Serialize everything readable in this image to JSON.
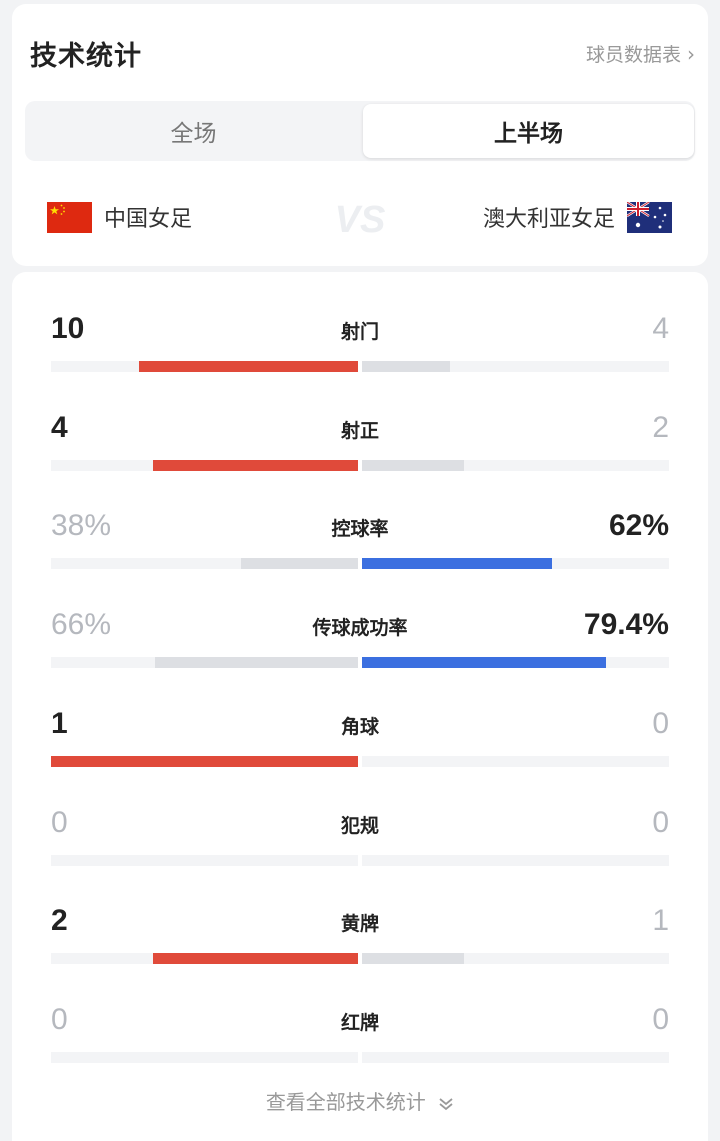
{
  "header": {
    "title": "技术统计",
    "player_link": "球员数据表"
  },
  "tabs": [
    {
      "label": "全场",
      "active": false
    },
    {
      "label": "上半场",
      "active": true
    }
  ],
  "teams": {
    "home": {
      "name": "中国女足",
      "flag": "china-flag-icon"
    },
    "vs_label": "VS",
    "away": {
      "name": "澳大利亚女足",
      "flag": "australia-flag-icon"
    }
  },
  "colors": {
    "home_accent": "#e04a3a",
    "away_accent": "#3b6fe0",
    "neutral_bar": "#dddfe3",
    "track": "#f3f4f6"
  },
  "stats": [
    {
      "label": "射门",
      "home": "10",
      "away": "4",
      "home_frac": 0.714,
      "away_frac": 0.286,
      "leader": "home"
    },
    {
      "label": "射正",
      "home": "4",
      "away": "2",
      "home_frac": 0.667,
      "away_frac": 0.333,
      "leader": "home"
    },
    {
      "label": "控球率",
      "home": "38%",
      "away": "62%",
      "home_frac": 0.38,
      "away_frac": 0.62,
      "leader": "away"
    },
    {
      "label": "传球成功率",
      "home": "66%",
      "away": "79.4%",
      "home_frac": 0.66,
      "away_frac": 0.794,
      "leader": "away"
    },
    {
      "label": "角球",
      "home": "1",
      "away": "0",
      "home_frac": 1.0,
      "away_frac": 0.0,
      "leader": "home"
    },
    {
      "label": "犯规",
      "home": "0",
      "away": "0",
      "home_frac": 0.0,
      "away_frac": 0.0,
      "leader": "none"
    },
    {
      "label": "黄牌",
      "home": "2",
      "away": "1",
      "home_frac": 0.667,
      "away_frac": 0.333,
      "leader": "home"
    },
    {
      "label": "红牌",
      "home": "0",
      "away": "0",
      "home_frac": 0.0,
      "away_frac": 0.0,
      "leader": "none"
    }
  ],
  "footer": {
    "more_label": "查看全部技术统计"
  }
}
